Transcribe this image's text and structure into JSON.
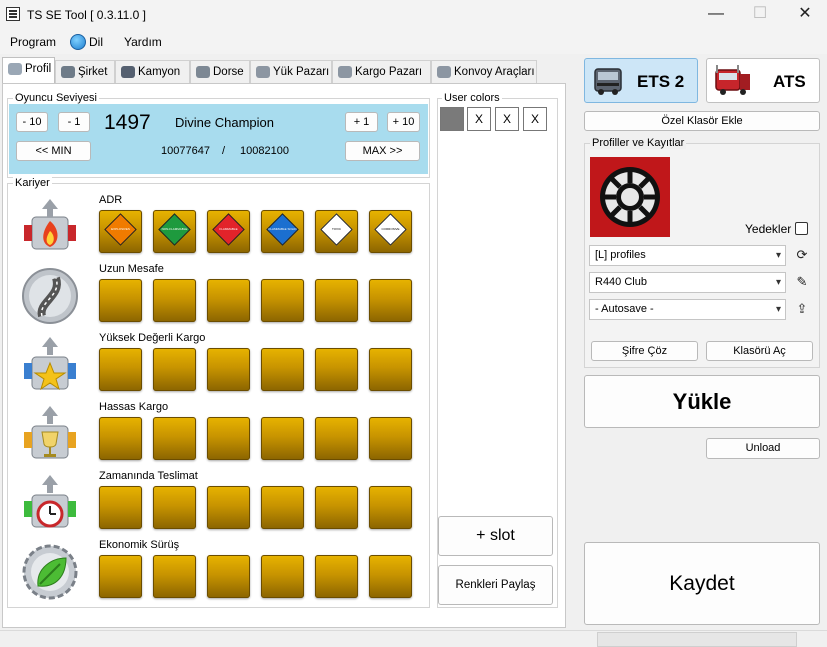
{
  "window": {
    "title": "TS SE Tool [ 0.3.11.0 ]",
    "min": "—",
    "max": "☐",
    "close": "✕"
  },
  "menu": [
    "Program",
    "Dil",
    "Yardım"
  ],
  "tabs": [
    "Profil",
    "Şirket",
    "Kamyon",
    "Dorse",
    "Yük Pazarı",
    "Kargo Pazarı",
    "Konvoy Araçları"
  ],
  "player_level": {
    "group_label": "Oyuncu Seviyesi",
    "minus10": "- 10",
    "minus1": "- 1",
    "level": "1497",
    "rank": "Divine Champion",
    "plus1": "+ 1",
    "plus10": "+ 10",
    "min_btn": "<< MIN",
    "max_btn": "MAX >>",
    "xp_current": "10077647",
    "xp_sep": "/",
    "xp_next": "10082100"
  },
  "career": {
    "group_label": "Kariyer",
    "skills": [
      {
        "label": "ADR",
        "icon": "adr-fire-icon",
        "level": 6
      },
      {
        "label": "Uzun Mesafe",
        "icon": "long-distance-road-icon",
        "level": 6
      },
      {
        "label": "Yüksek Değerli Kargo",
        "icon": "high-value-cargo-icon",
        "level": 6
      },
      {
        "label": "Hassas Kargo",
        "icon": "fragile-cargo-icon",
        "level": 6
      },
      {
        "label": "Zamanında Teslimat",
        "icon": "just-in-time-icon",
        "level": 6
      },
      {
        "label": "Ekonomik Sürüş",
        "icon": "eco-driving-icon",
        "level": 6
      }
    ],
    "adr_classes": [
      {
        "code": "EXPLOSIVES",
        "color": "#f07b00"
      },
      {
        "code": "NON-FLAMMABLE",
        "color": "#1e9a3e"
      },
      {
        "code": "FLAMMABLE",
        "color": "#e2232a"
      },
      {
        "code": "FLAMMABLE SOLID",
        "color": "#1b6fd0"
      },
      {
        "code": "TOXIC",
        "color": "#ffffff"
      },
      {
        "code": "CORROSIVE",
        "color": "#ffffff"
      }
    ]
  },
  "user_colors": {
    "group_label": "User colors",
    "slots": [
      {
        "color": "#7a7a7a",
        "text": ""
      },
      {
        "text": "X"
      },
      {
        "text": "X"
      },
      {
        "text": "X"
      }
    ],
    "add_slot": "+ slot",
    "share": "Renkleri Paylaş"
  },
  "right": {
    "ets2": "ETS 2",
    "ats": "ATS",
    "custom_folder": "Özel Klasör Ekle",
    "profiles_label": "Profiller ve Kayıtlar",
    "backups_label": "Yedekler",
    "profile_source": "[L] profiles",
    "profile": "R440 Club",
    "save": "- Autosave -",
    "decrypt": "Şifre Çöz",
    "open_folder": "Klasörü Aç",
    "load": "Yükle",
    "unload": "Unload",
    "save_btn": "Kaydet"
  }
}
